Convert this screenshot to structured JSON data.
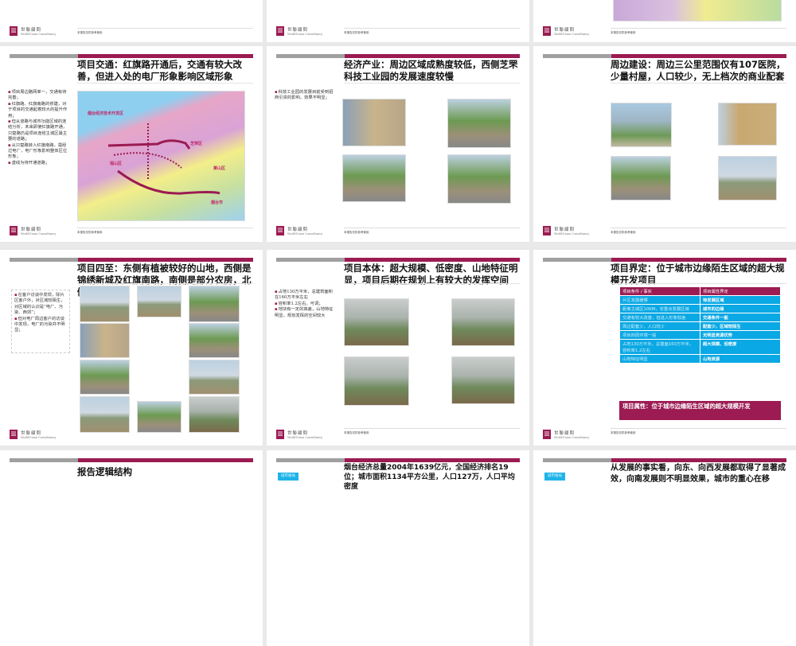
{
  "footer": {
    "logo_cn": "世聯顧問",
    "logo_en": "WorldUnion Consultancy",
    "note": "本报告仅供参考使用"
  },
  "slides": {
    "traffic": {
      "title": "项目交通：红旗路开通后，交通有较大改善，但进入处的电厂形象影响区域形象",
      "bullets": [
        "项目周边路网单一，交通有待完善；",
        "红旗路、红旗南路的修建，对于项目的交通起着较大的提升作用；",
        "但从道路与城市功能区域的连结分析，未来即使红旗路开通，只楚路仍是项目连结主城区最主要的道路；",
        "从只楚路转入红旗南路，需经过电厂，电厂形象影响整体区位形象；",
        "虚线为待开通道路；"
      ],
      "map_labels": [
        "烟台经济技术开发区",
        "芝罘区",
        "福山区",
        "莱山区",
        "烟台市"
      ]
    },
    "economy": {
      "title": "经济产业：周边区域成熟度较低，西侧芝罘科技工业园的发展速度较慢",
      "bullets": [
        "科技工业园的发展目前受到招商引资的影响，效果不明显；"
      ]
    },
    "surround": {
      "title": "周边建设：周边三公里范围仅有107医院，少量村屋，人口较少，无上档次的商业配套"
    },
    "borders": {
      "title": "项目四至：东侧有植被较好的山地，西侧是锦绣新城及红旗南路，南侧是部分农房，北侧是电厂",
      "bullets": [
        "在客户访谈中发现，除片区客户外，对区域较陌生，对区域的认识是“电厂、污染、西郊”；",
        "但对电厂周边客户的访谈中发现，电厂的污染并不明显；"
      ]
    },
    "body": {
      "title": "项目本体：超大规模、低密度、山地特征明显，项目后期在规划上有较大的发挥空间",
      "bullets": [
        "占地130万平米，总建筑面积在160万平米左右",
        "容积率1.2左右，可调；",
        "地块有一定的高差，山地特征明显，规划发挥的空间较大"
      ]
    },
    "define": {
      "title": "项目界定：位于城市边缘陌生区域的超大规模开发项目",
      "headers": [
        "项目条件 / 事实",
        "项目属性界定"
      ],
      "rows": [
        [
          "片区发展缓慢",
          "待发展区域"
        ],
        [
          "距离主城区10KM，非重点发展区域",
          "城市的边缘"
        ],
        [
          "交通有较大改善，但进入形象较差",
          "交通条件一般"
        ],
        [
          "周边配套少，人口较少",
          "配套少，区域较陌生"
        ],
        [
          "项目四周环境一般",
          "无明显资源优势"
        ],
        [
          "占地130万平米，总建面160万平米，容积率1.2左右",
          "超大规模、低密度"
        ],
        [
          "山地特征明显",
          "山地资源"
        ]
      ],
      "conclusion": "项目属性：位于城市边缘陌生区域的超大规模开发"
    },
    "logic": {
      "title": "报告逻辑结构"
    },
    "city1": {
      "tag": "城市格局",
      "title": "烟台经济总量2004年1639亿元，全国经济排名19位；城市面积1134平方公里，人口127万，人口平均密度"
    },
    "city2": {
      "tag": "城市格局",
      "title": "从发展的事实看，向东、向西发展都取得了显著成效，向南发展则不明显效果，城市的重心在移"
    }
  }
}
